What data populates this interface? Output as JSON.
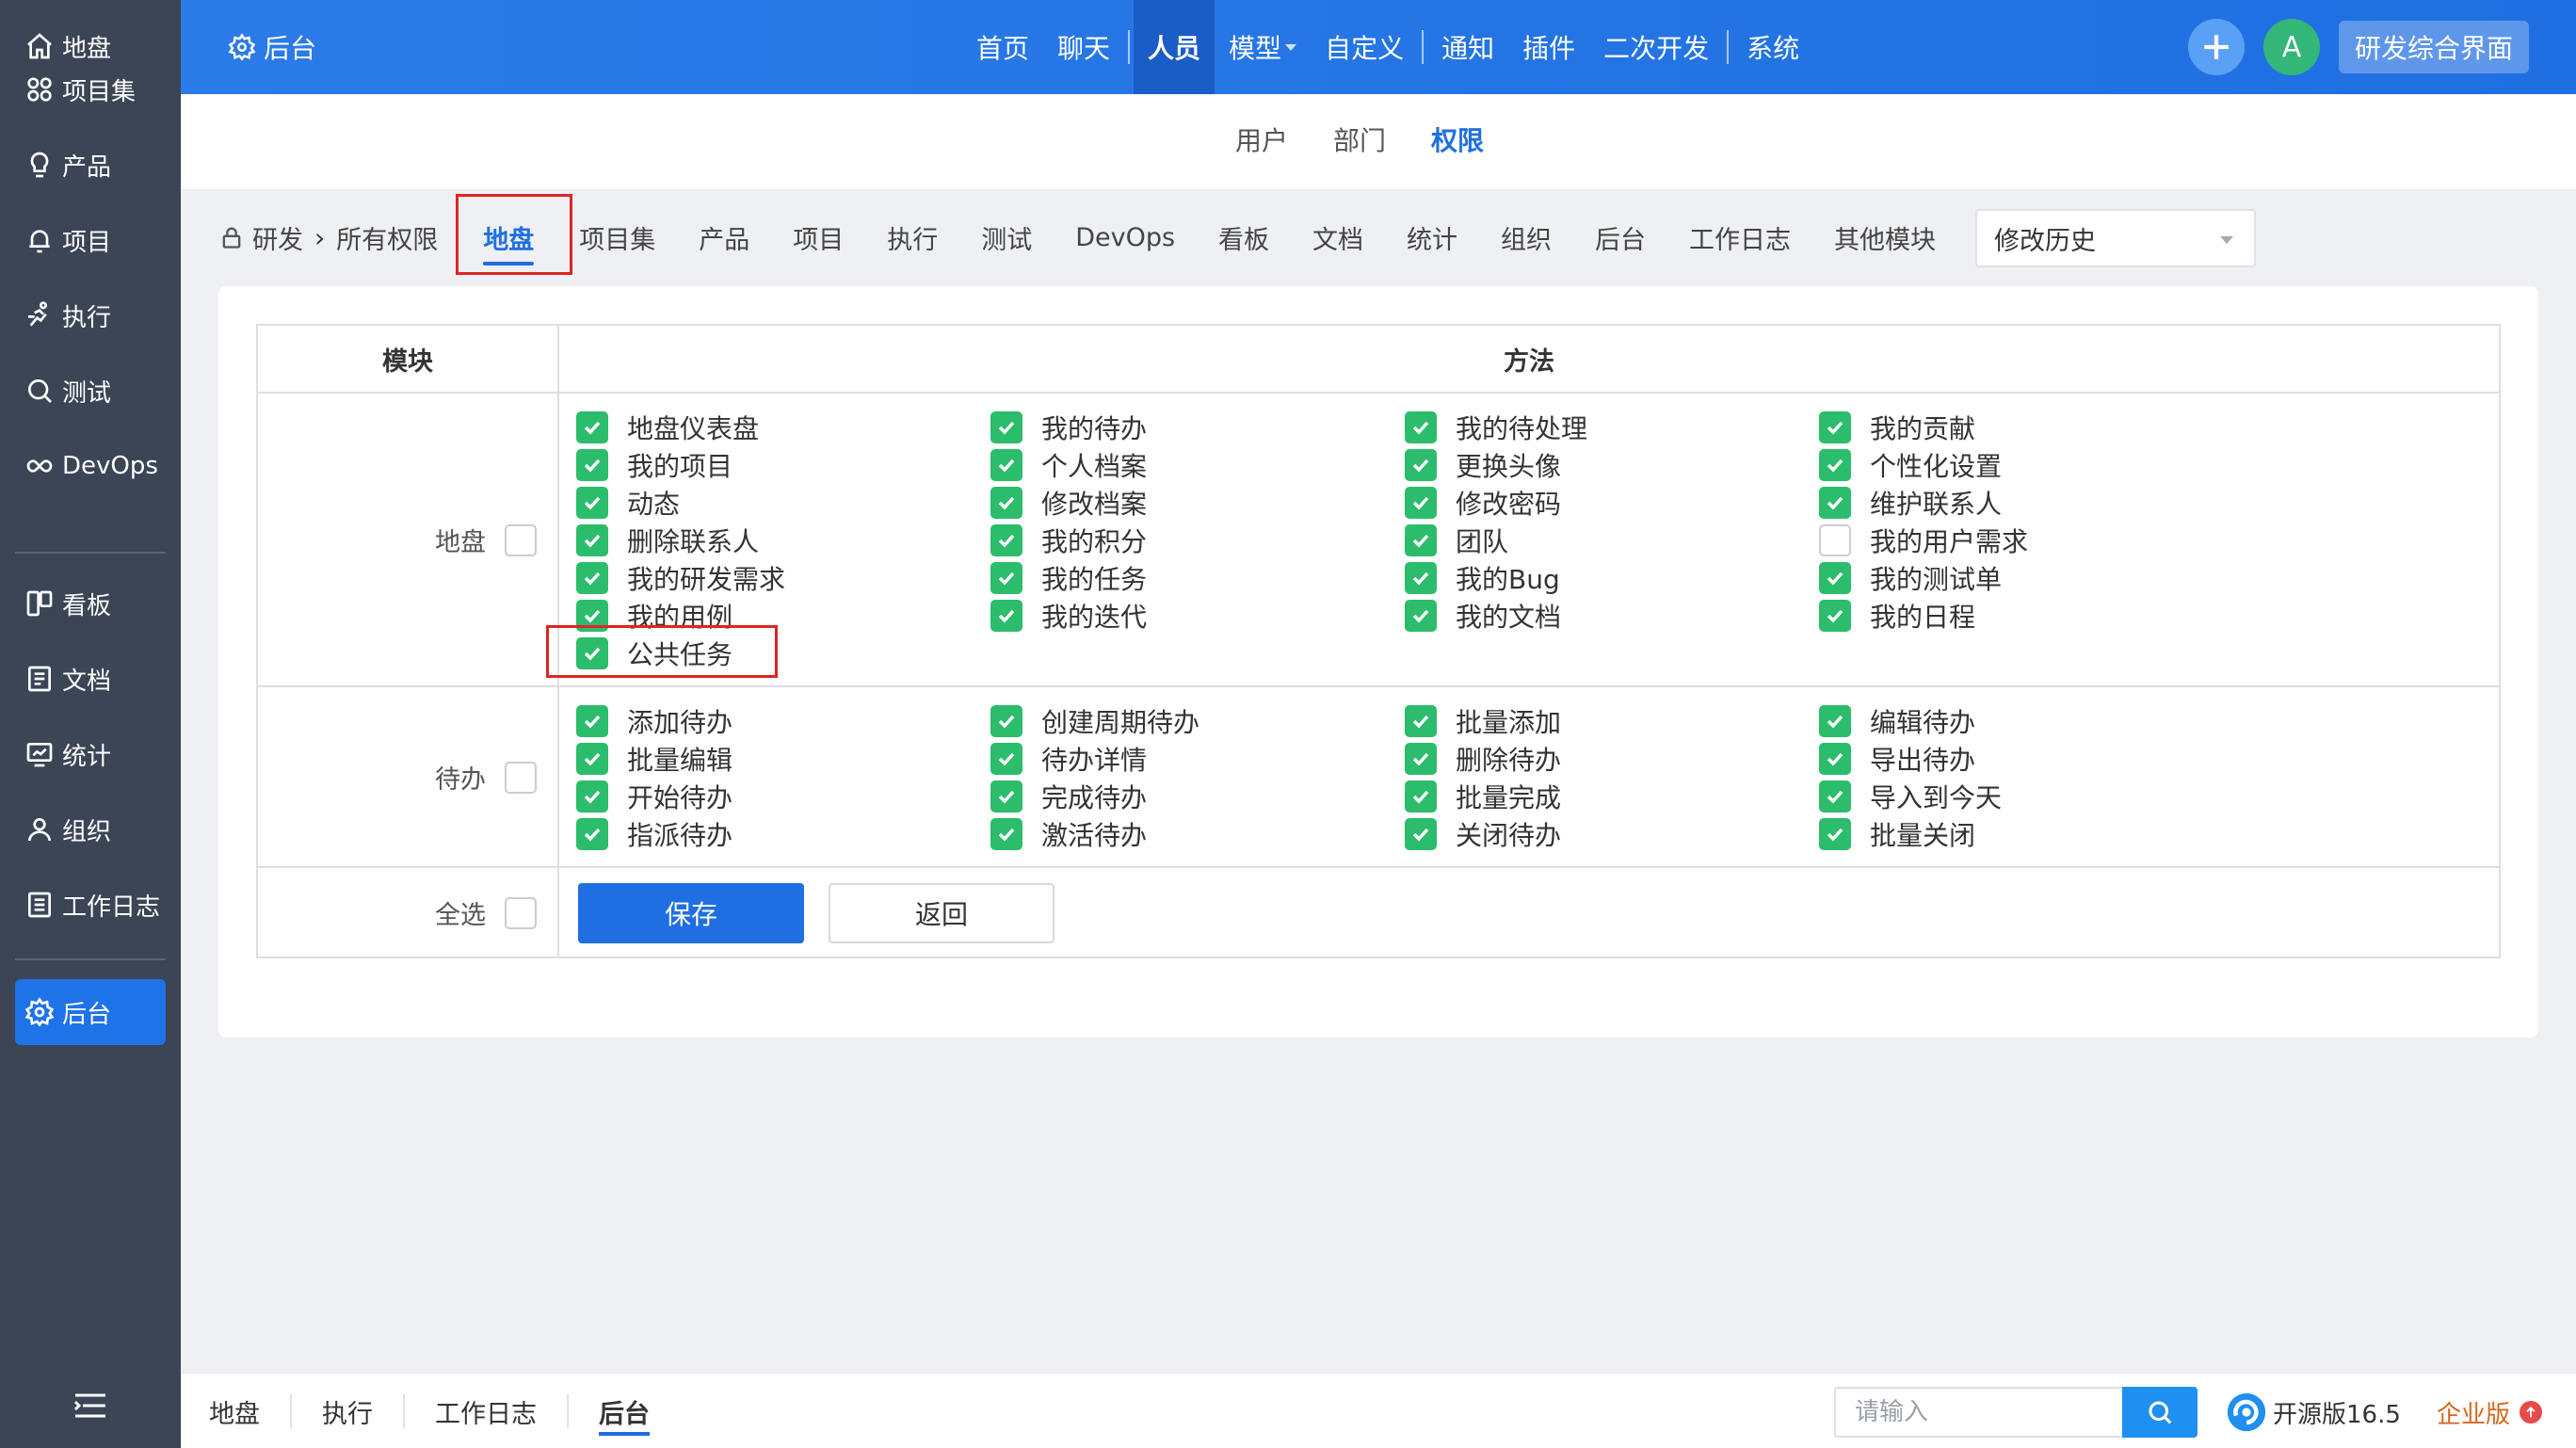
{
  "sidebar": {
    "items": [
      {
        "label": "地盘",
        "icon": "home-icon"
      },
      {
        "label": "项目集",
        "icon": "grid-icon"
      },
      {
        "label": "产品",
        "icon": "lightbulb-icon"
      },
      {
        "label": "项目",
        "icon": "bell-icon"
      },
      {
        "label": "执行",
        "icon": "run-icon"
      },
      {
        "label": "测试",
        "icon": "search-test-icon"
      },
      {
        "label": "DevOps",
        "icon": "infinity-icon"
      },
      {
        "label": "看板",
        "icon": "kanban-icon"
      },
      {
        "label": "文档",
        "icon": "document-icon"
      },
      {
        "label": "统计",
        "icon": "monitor-chart-icon"
      },
      {
        "label": "组织",
        "icon": "user-icon"
      },
      {
        "label": "工作日志",
        "icon": "log-icon"
      },
      {
        "label": "后台",
        "icon": "gear-icon"
      }
    ],
    "active": "后台"
  },
  "topbar": {
    "brand": "后台",
    "nav": [
      "首页",
      "聊天",
      "人员",
      "模型",
      "自定义",
      "通知",
      "插件",
      "二次开发",
      "系统"
    ],
    "active_nav": "人员",
    "avatar_letter": "A",
    "rd_button": "研发综合界面"
  },
  "subnav": {
    "tabs": [
      "用户",
      "部门",
      "权限"
    ],
    "active": "权限"
  },
  "modules": {
    "breadcrumb_root": "研发",
    "breadcrumb_all": "所有权限",
    "tabs": [
      "地盘",
      "项目集",
      "产品",
      "项目",
      "执行",
      "测试",
      "DevOps",
      "看板",
      "文档",
      "统计",
      "组织",
      "后台",
      "工作日志",
      "其他模块"
    ],
    "active": "地盘",
    "history_select": "修改历史"
  },
  "table": {
    "header_module": "模块",
    "header_method": "方法",
    "groups": [
      {
        "module": "地盘",
        "module_checked": false,
        "items": [
          {
            "label": "地盘仪表盘",
            "checked": true
          },
          {
            "label": "我的待办",
            "checked": true
          },
          {
            "label": "我的待处理",
            "checked": true
          },
          {
            "label": "我的贡献",
            "checked": true
          },
          {
            "label": "我的项目",
            "checked": true
          },
          {
            "label": "个人档案",
            "checked": true
          },
          {
            "label": "更换头像",
            "checked": true
          },
          {
            "label": "个性化设置",
            "checked": true
          },
          {
            "label": "动态",
            "checked": true
          },
          {
            "label": "修改档案",
            "checked": true
          },
          {
            "label": "修改密码",
            "checked": true
          },
          {
            "label": "维护联系人",
            "checked": true
          },
          {
            "label": "删除联系人",
            "checked": true
          },
          {
            "label": "我的积分",
            "checked": true
          },
          {
            "label": "团队",
            "checked": true
          },
          {
            "label": "我的用户需求",
            "checked": false
          },
          {
            "label": "我的研发需求",
            "checked": true
          },
          {
            "label": "我的任务",
            "checked": true
          },
          {
            "label": "我的Bug",
            "checked": true
          },
          {
            "label": "我的测试单",
            "checked": true
          },
          {
            "label": "我的用例",
            "checked": true
          },
          {
            "label": "我的迭代",
            "checked": true
          },
          {
            "label": "我的文档",
            "checked": true
          },
          {
            "label": "我的日程",
            "checked": true
          },
          {
            "label": "公共任务",
            "checked": true
          }
        ]
      },
      {
        "module": "待办",
        "module_checked": false,
        "items": [
          {
            "label": "添加待办",
            "checked": true
          },
          {
            "label": "创建周期待办",
            "checked": true
          },
          {
            "label": "批量添加",
            "checked": true
          },
          {
            "label": "编辑待办",
            "checked": true
          },
          {
            "label": "批量编辑",
            "checked": true
          },
          {
            "label": "待办详情",
            "checked": true
          },
          {
            "label": "删除待办",
            "checked": true
          },
          {
            "label": "导出待办",
            "checked": true
          },
          {
            "label": "开始待办",
            "checked": true
          },
          {
            "label": "完成待办",
            "checked": true
          },
          {
            "label": "批量完成",
            "checked": true
          },
          {
            "label": "导入到今天",
            "checked": true
          },
          {
            "label": "指派待办",
            "checked": true
          },
          {
            "label": "激活待办",
            "checked": true
          },
          {
            "label": "关闭待办",
            "checked": true
          },
          {
            "label": "批量关闭",
            "checked": true
          }
        ]
      }
    ],
    "select_all_label": "全选",
    "save_label": "保存",
    "back_label": "返回"
  },
  "bottombar": {
    "tasks": [
      "地盘",
      "执行",
      "工作日志",
      "后台"
    ],
    "active": "后台",
    "search_placeholder": "请输入",
    "version": "开源版16.5",
    "enterprise": "企业版"
  },
  "colors": {
    "accent": "#1f6fe2",
    "sidebar_bg": "#3b4556",
    "checkbox_on": "#2bbd6b",
    "highlight": "#e02424"
  }
}
